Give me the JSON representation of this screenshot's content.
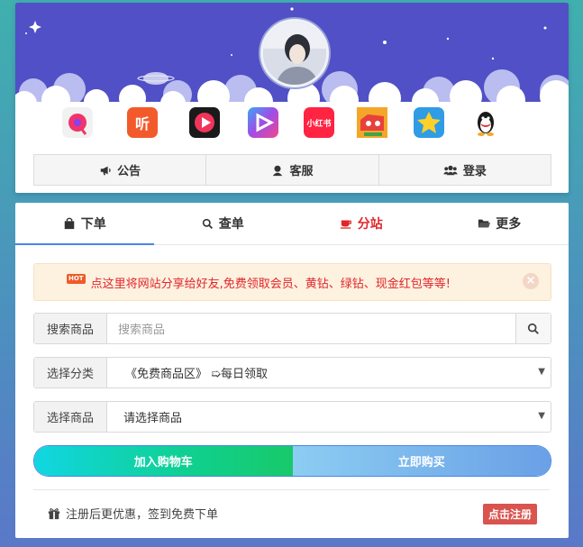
{
  "top_buttons": [
    {
      "label": "公告",
      "icon": "megaphone-icon"
    },
    {
      "label": "客服",
      "icon": "user-service-icon"
    },
    {
      "label": "登录",
      "icon": "users-icon"
    }
  ],
  "apps": [
    {
      "name": "music-app-icon",
      "label": "",
      "color": "#f1f1f1"
    },
    {
      "name": "listen-app-icon",
      "label": "听",
      "color": "#f35a2b"
    },
    {
      "name": "video-play-app-icon",
      "label": "",
      "color": "#1a1a1a"
    },
    {
      "name": "video-app-icon",
      "label": "",
      "color": "#7a4ce0"
    },
    {
      "name": "xiaohongshu-app-icon",
      "label": "小红书",
      "color": "#ff2442"
    },
    {
      "name": "game-app-icon",
      "label": "",
      "color": "#f6c12b"
    },
    {
      "name": "qzone-app-icon",
      "label": "",
      "color": "#2f9ce5"
    },
    {
      "name": "qq-app-icon",
      "label": "",
      "color": "#ffffff"
    }
  ],
  "tabs": [
    {
      "label": "下单",
      "icon": "shopping-bag-icon"
    },
    {
      "label": "查单",
      "icon": "search-icon"
    },
    {
      "label": "分站",
      "icon": "cup-icon"
    },
    {
      "label": "更多",
      "icon": "folder-icon"
    }
  ],
  "notice": {
    "badge": "HOT",
    "text": "点这里将网站分享给好友,免费领取会员、黄钻、绿钻、现金红包等等!"
  },
  "search": {
    "label": "搜索商品",
    "placeholder": "搜索商品"
  },
  "category": {
    "label": "选择分类",
    "value": "《免费商品区》 ➯每日领取"
  },
  "product": {
    "label": "选择商品",
    "value": "请选择商品"
  },
  "actions": {
    "cart": "加入购物车",
    "buy": "立即购买"
  },
  "promo": {
    "text": "注册后更优惠，签到免费下单",
    "register": "点击注册"
  },
  "colors": {
    "banner": "#5150c6",
    "accent": "#4a86e8",
    "red": "#e0262a"
  }
}
